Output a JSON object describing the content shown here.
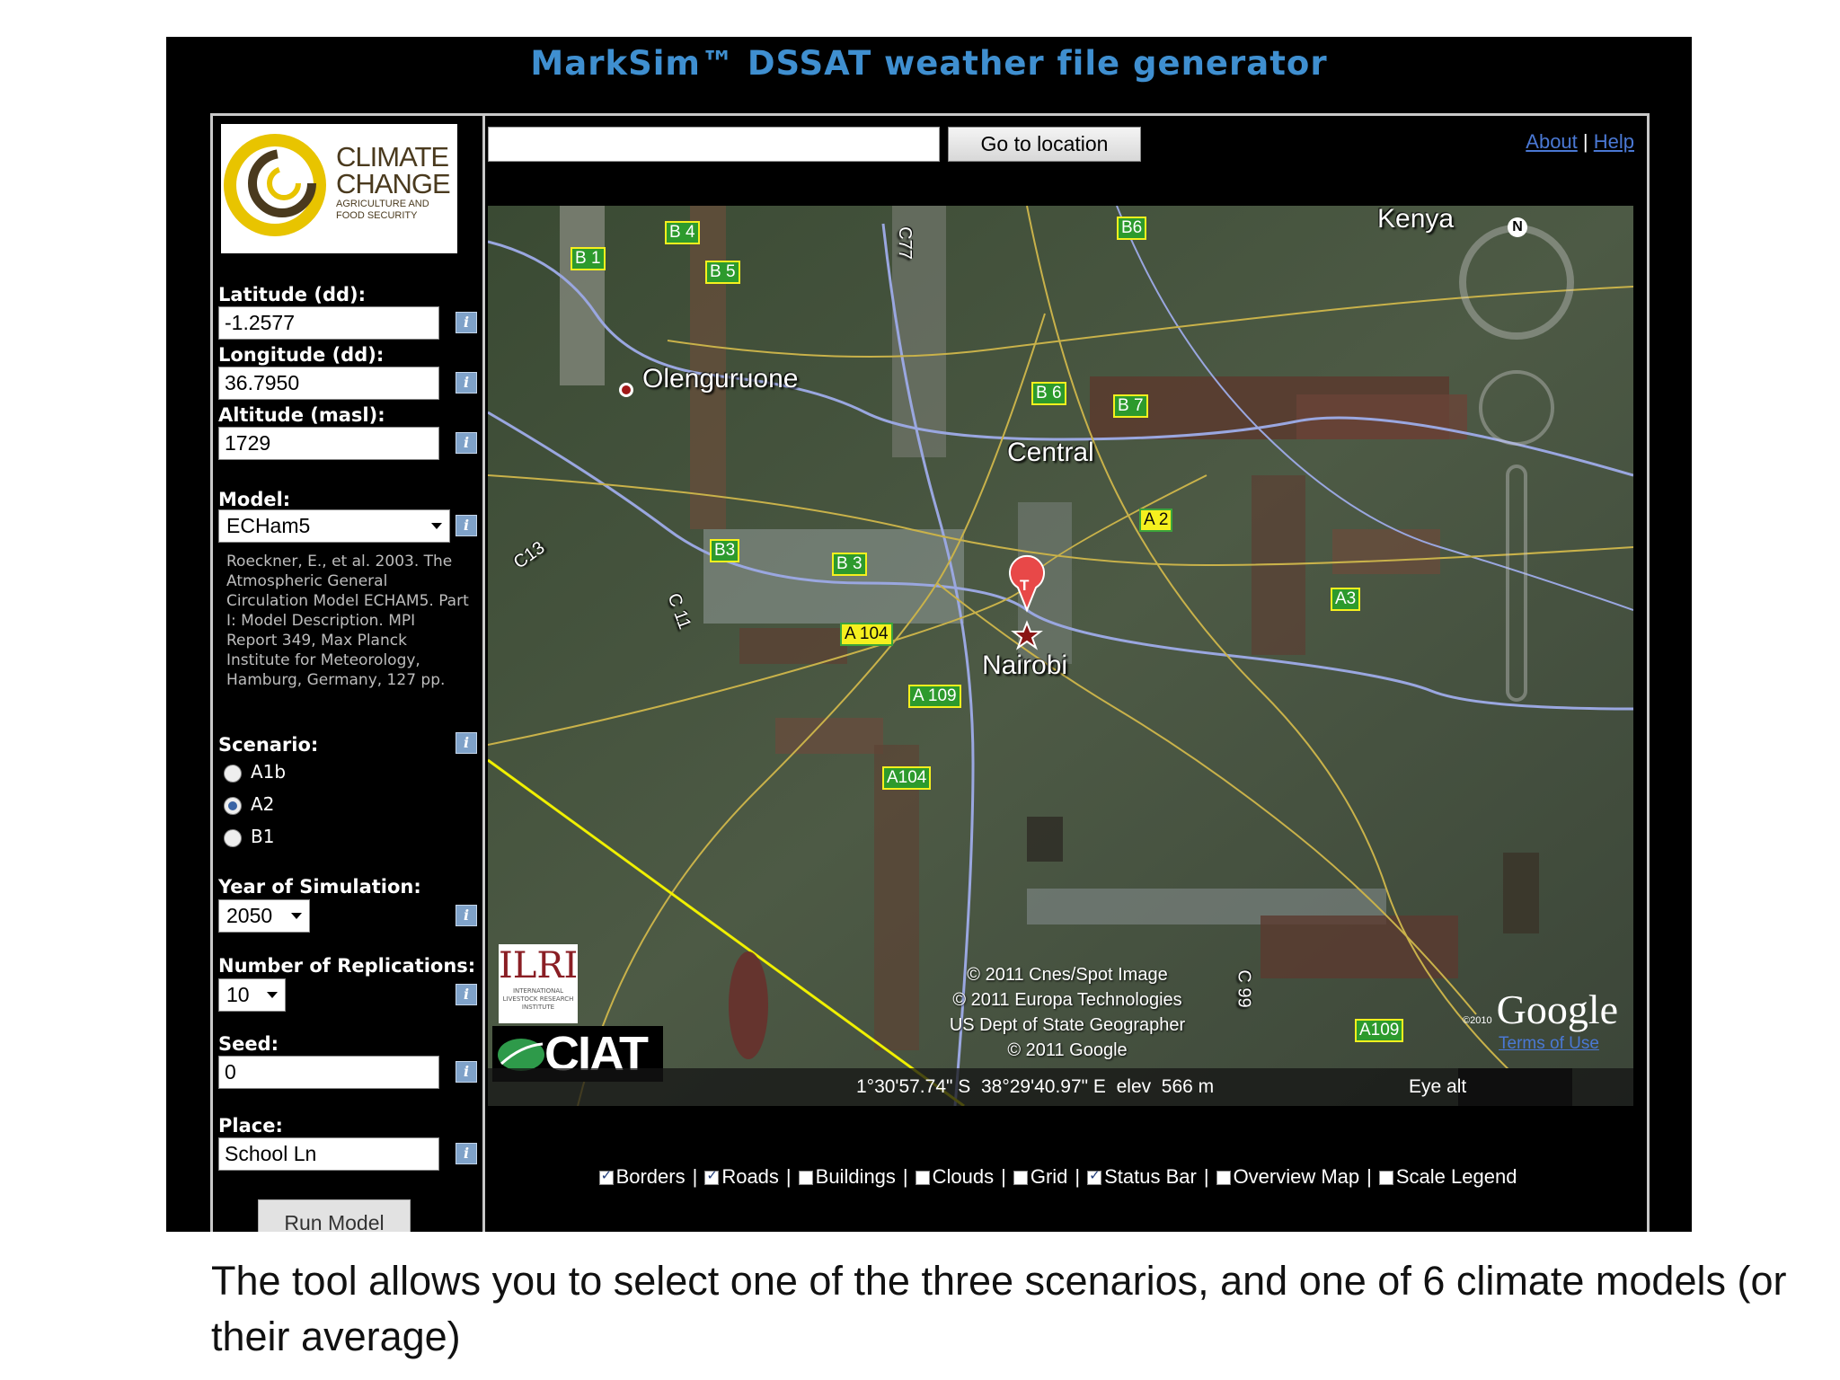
{
  "app": {
    "title": "MarkSim™ DSSAT weather file generator"
  },
  "logo": {
    "line1": "CLIMATE",
    "line2": "CHANGE",
    "line3": "AGRICULTURE AND",
    "line4": "FOOD SECURITY"
  },
  "form": {
    "latitude_label": "Latitude (dd):",
    "latitude_value": "-1.2577",
    "longitude_label": "Longitude (dd):",
    "longitude_value": "36.7950",
    "altitude_label": "Altitude (masl):",
    "altitude_value": "1729",
    "model_label": "Model:",
    "model_value": "ECHam5",
    "model_description": "Roeckner, E., et al. 2003. The Atmospheric General Circulation Model ECHAM5. Part I: Model Description. MPI Report 349, Max Planck Institute for Meteorology, Hamburg, Germany, 127 pp.",
    "scenario_label": "Scenario:",
    "scenarios": [
      {
        "label": "A1b",
        "selected": false
      },
      {
        "label": "A2",
        "selected": true
      },
      {
        "label": "B1",
        "selected": false
      }
    ],
    "year_label": "Year of Simulation:",
    "year_value": "2050",
    "replications_label": "Number of Replications:",
    "replications_value": "10",
    "seed_label": "Seed:",
    "seed_value": "0",
    "place_label": "Place:",
    "place_value": "School Ln",
    "run_label": "Run Model",
    "info_glyph": "i"
  },
  "toolbar": {
    "go_label": "Go to location",
    "about_label": "About",
    "help_label": "Help",
    "divider": "|"
  },
  "map": {
    "place_labels": {
      "kenya": "Kenya",
      "olenguruone": "Olenguruone",
      "central": "Central",
      "nairobi": "Nairobi"
    },
    "road_labels": [
      "B 1",
      "B 4",
      "B 5",
      "B6",
      "B 6",
      "B 7",
      "A 2",
      "B3",
      "B 3",
      "A3",
      "A 104",
      "A 109",
      "A104",
      "A109",
      "C77",
      "C13",
      "C 11",
      "C 99"
    ],
    "marker_label": "T",
    "compass_label": "N",
    "credits": [
      "© 2011 Cnes/Spot Image",
      "© 2011 Europa Technologies",
      "US Dept of State Geographer",
      "© 2011 Google"
    ],
    "status": {
      "coords": "1°30'57.74\" S  38°29'40.97\" E  elev  566 m",
      "eye_alt": "Eye alt"
    },
    "google_copyright": "©2010",
    "google": "Google",
    "terms": "Terms of Use",
    "ilri": "ILRI",
    "ilri_sub": "INTERNATIONAL LIVESTOCK RESEARCH INSTITUTE",
    "ciat": "CIAT"
  },
  "layers": [
    {
      "label": "Borders",
      "checked": true
    },
    {
      "label": "Roads",
      "checked": true
    },
    {
      "label": "Buildings",
      "checked": false
    },
    {
      "label": "Clouds",
      "checked": false
    },
    {
      "label": "Grid",
      "checked": false
    },
    {
      "label": "Status Bar",
      "checked": true
    },
    {
      "label": "Overview Map",
      "checked": false
    },
    {
      "label": "Scale Legend",
      "checked": false
    }
  ],
  "caption": "The tool allows you to select one of the three scenarios, and one of 6 climate models (or their average)",
  "colors": {
    "title": "#3f8fd0",
    "link": "#4a78d4",
    "road_yellow": "#f5f01e",
    "road_green": "#2d9a2d"
  }
}
